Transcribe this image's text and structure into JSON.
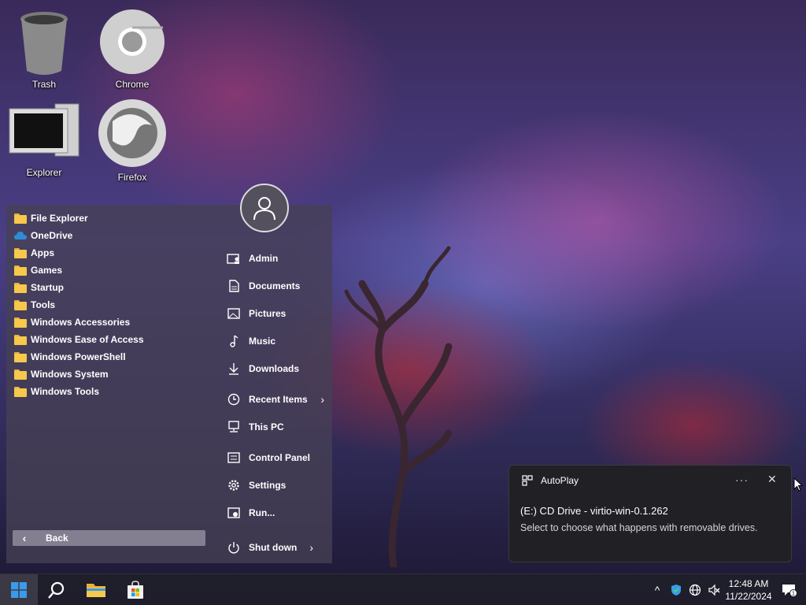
{
  "desktop": {
    "icons": [
      {
        "label": "Trash",
        "icon": "trash-icon"
      },
      {
        "label": "Chrome",
        "icon": "chrome-icon"
      },
      {
        "label": "Explorer",
        "icon": "computer-icon"
      },
      {
        "label": "Firefox",
        "icon": "firefox-icon"
      }
    ]
  },
  "start_menu": {
    "programs": [
      {
        "label": "File Explorer",
        "icon": "folder-icon"
      },
      {
        "label": "OneDrive",
        "icon": "cloud-icon"
      },
      {
        "label": "Apps",
        "icon": "folder-icon"
      },
      {
        "label": "Games",
        "icon": "folder-icon"
      },
      {
        "label": "Startup",
        "icon": "folder-icon"
      },
      {
        "label": "Tools",
        "icon": "folder-icon"
      },
      {
        "label": "Windows Accessories",
        "icon": "folder-icon"
      },
      {
        "label": "Windows Ease of Access",
        "icon": "folder-icon"
      },
      {
        "label": "Windows PowerShell",
        "icon": "folder-icon"
      },
      {
        "label": "Windows System",
        "icon": "folder-icon"
      },
      {
        "label": "Windows Tools",
        "icon": "folder-icon"
      }
    ],
    "back_label": "Back",
    "places": [
      {
        "label": "Admin",
        "icon": "user-folder-icon"
      },
      {
        "label": "Documents",
        "icon": "document-icon"
      },
      {
        "label": "Pictures",
        "icon": "picture-icon"
      },
      {
        "label": "Music",
        "icon": "music-icon"
      },
      {
        "label": "Downloads",
        "icon": "download-icon"
      },
      {
        "label": "Recent Items",
        "icon": "clock-icon",
        "arrow": "›"
      },
      {
        "label": "This PC",
        "icon": "pc-icon"
      },
      {
        "label": "Control Panel",
        "icon": "control-panel-icon"
      },
      {
        "label": "Settings",
        "icon": "gear-icon"
      },
      {
        "label": "Run...",
        "icon": "run-icon"
      }
    ],
    "shutdown_label": "Shut down",
    "shutdown_arrow": "›"
  },
  "notification": {
    "app": "AutoPlay",
    "more": "···",
    "close": "✕",
    "title": "(E:) CD Drive - virtio-win-0.1.262",
    "body": "Select to choose what happens with removable drives."
  },
  "taskbar": {
    "time": "12:48 AM",
    "date": "11/22/2024",
    "notification_count": "1",
    "tray_chevron": "^"
  },
  "colors": {
    "accent": "#2f8bd8",
    "folder": "#f6c84b",
    "menu_bg": "#46405a",
    "toast_bg": "#202025"
  }
}
